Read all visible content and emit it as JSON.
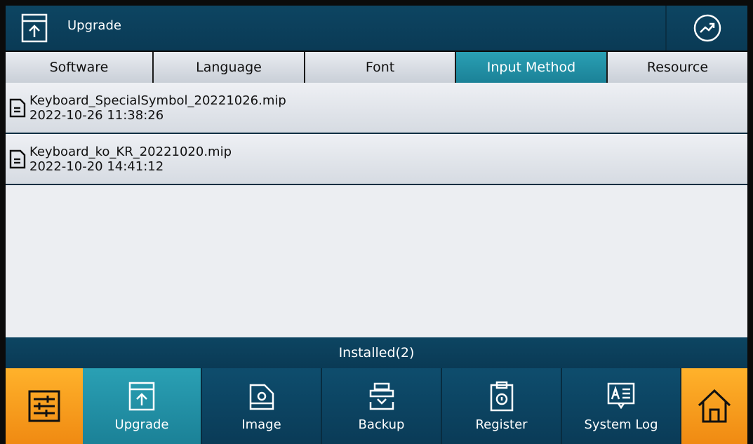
{
  "header": {
    "title": "Upgrade"
  },
  "tabs": [
    {
      "label": "Software",
      "active": false
    },
    {
      "label": "Language",
      "active": false
    },
    {
      "label": "Font",
      "active": false
    },
    {
      "label": "Input Method",
      "active": true
    },
    {
      "label": "Resource",
      "active": false
    }
  ],
  "files": [
    {
      "name": "Keyboard_SpecialSymbol_20221026.mip",
      "date": "2022-10-26 11:38:26"
    },
    {
      "name": "Keyboard_ko_KR_20221020.mip",
      "date": "2022-10-20 14:41:12"
    }
  ],
  "status": {
    "installed": "Installed(2)"
  },
  "nav": [
    {
      "label": "Upgrade",
      "icon": "upgrade-box-icon"
    },
    {
      "label": "Image",
      "icon": "image-icon"
    },
    {
      "label": "Backup",
      "icon": "backup-icon"
    },
    {
      "label": "Register",
      "icon": "register-icon"
    },
    {
      "label": "System Log",
      "icon": "system-log-icon"
    }
  ],
  "colors": {
    "accent": "#2aa0b4",
    "dark": "#0d4562",
    "orange": "#f59a1c"
  }
}
